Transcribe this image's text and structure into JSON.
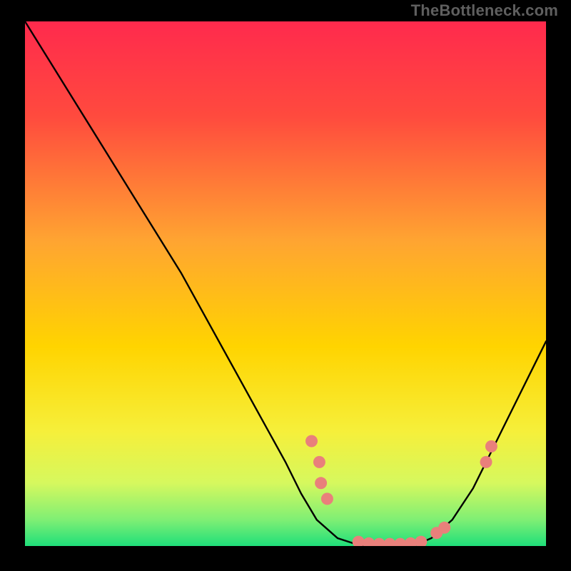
{
  "watermark": "TheBottleneck.com",
  "colors": {
    "background": "#000000",
    "gradient_top": "#ff2a4d",
    "gradient_mid": "#ffd400",
    "gradient_green_light": "#c8ff6e",
    "gradient_green": "#1fdf7a",
    "curve": "#000000",
    "dot_fill": "#e9807b",
    "dot_stroke": "#d76d68"
  },
  "chart_data": {
    "type": "line",
    "title": "",
    "xlabel": "",
    "ylabel": "",
    "xlim": [
      0,
      100
    ],
    "ylim": [
      0,
      100
    ],
    "x": [
      0,
      5,
      10,
      15,
      20,
      25,
      30,
      35,
      40,
      45,
      50,
      53,
      56,
      60,
      64,
      68,
      72,
      75,
      78,
      82,
      86,
      90,
      94,
      100
    ],
    "values": [
      100,
      92,
      84,
      76,
      68,
      60,
      52,
      43,
      34,
      25,
      16,
      10,
      5,
      1.5,
      0.2,
      0,
      0,
      0.2,
      1.5,
      5,
      11,
      19,
      27,
      39
    ],
    "dots": [
      {
        "x": 55.0,
        "y": 20.0
      },
      {
        "x": 56.5,
        "y": 16.0
      },
      {
        "x": 56.8,
        "y": 12.0
      },
      {
        "x": 58.0,
        "y": 9.0
      },
      {
        "x": 64.0,
        "y": 0.8
      },
      {
        "x": 66.0,
        "y": 0.5
      },
      {
        "x": 68.0,
        "y": 0.4
      },
      {
        "x": 70.0,
        "y": 0.4
      },
      {
        "x": 72.0,
        "y": 0.4
      },
      {
        "x": 74.0,
        "y": 0.5
      },
      {
        "x": 76.0,
        "y": 0.8
      },
      {
        "x": 79.0,
        "y": 2.5
      },
      {
        "x": 80.5,
        "y": 3.5
      },
      {
        "x": 88.5,
        "y": 16.0
      },
      {
        "x": 89.5,
        "y": 19.0
      }
    ]
  }
}
